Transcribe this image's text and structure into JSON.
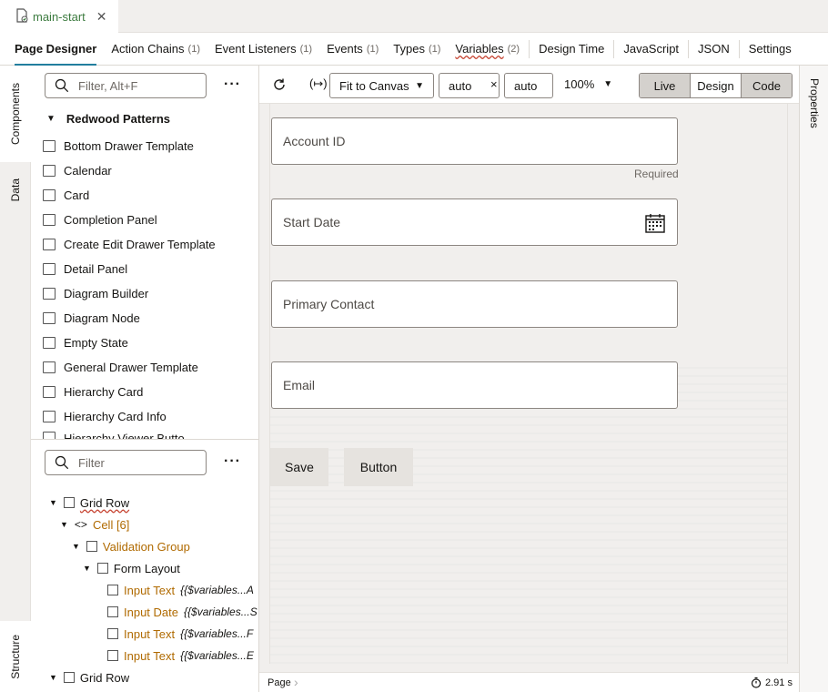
{
  "doc_tab": {
    "title": "main-start"
  },
  "main_tabs": [
    {
      "label": "Page Designer",
      "count": ""
    },
    {
      "label": "Action Chains",
      "count": "(1)"
    },
    {
      "label": "Event Listeners",
      "count": "(1)"
    },
    {
      "label": "Events",
      "count": "(1)"
    },
    {
      "label": "Types",
      "count": "(1)"
    },
    {
      "label": "Variables",
      "count": "(2)"
    },
    {
      "label": "Design Time",
      "count": ""
    },
    {
      "label": "JavaScript",
      "count": ""
    },
    {
      "label": "JSON",
      "count": ""
    },
    {
      "label": "Settings",
      "count": ""
    }
  ],
  "left_rail": {
    "components": "Components",
    "data": "Data",
    "structure": "Structure"
  },
  "components": {
    "search_placeholder": "Filter, Alt+F",
    "more": "···",
    "group": "Redwood Patterns",
    "items": [
      "Bottom Drawer Template",
      "Calendar",
      "Card",
      "Completion Panel",
      "Create Edit Drawer Template",
      "Detail Panel",
      "Diagram Builder",
      "Diagram Node",
      "Empty State",
      "General Drawer Template",
      "Hierarchy Card",
      "Hierarchy Card Info",
      "Hierarchy Viewer Butto..."
    ]
  },
  "structure": {
    "search_placeholder": "Filter",
    "more": "···",
    "nodes": [
      {
        "label": "Grid Row",
        "detail": ""
      },
      {
        "label": "Cell [6]",
        "detail": ""
      },
      {
        "label": "Validation Group",
        "detail": ""
      },
      {
        "label": "Form Layout",
        "detail": ""
      },
      {
        "label": "Input Text",
        "detail": "{{$variables...A"
      },
      {
        "label": "Input Date",
        "detail": "{{$variables...S"
      },
      {
        "label": "Input Text",
        "detail": "{{$variables...F"
      },
      {
        "label": "Input Text",
        "detail": "{{$variables...E"
      },
      {
        "label": "Grid Row",
        "detail": ""
      }
    ]
  },
  "toolbar": {
    "fit": "Fit to Canvas",
    "width": "auto",
    "times": "×",
    "height": "auto",
    "zoom": "100%",
    "modes": [
      "Live",
      "Design",
      "Code"
    ]
  },
  "form": {
    "account_id": "Account ID",
    "required": "Required",
    "start_date": "Start Date",
    "primary_contact": "Primary Contact",
    "email": "Email",
    "save": "Save",
    "button": "Button"
  },
  "statusbar": {
    "page": "Page",
    "time": "2.91 s"
  },
  "right_rail": {
    "properties": "Properties"
  }
}
